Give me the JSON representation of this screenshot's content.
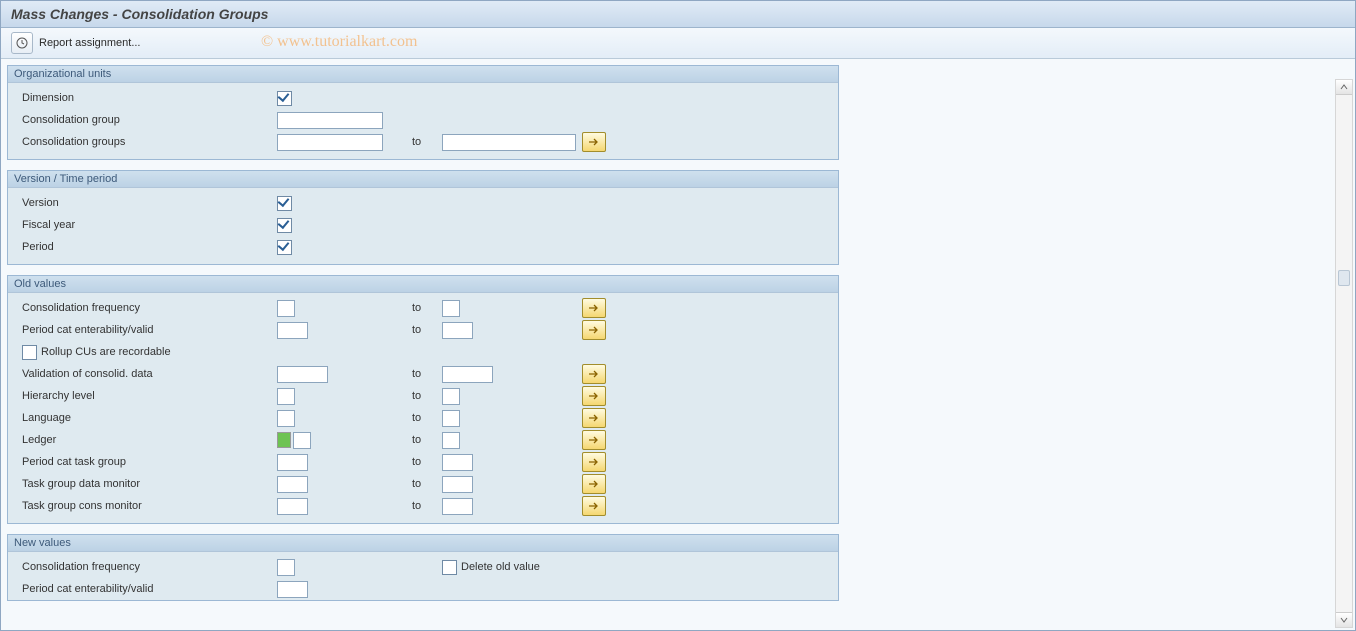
{
  "title": "Mass Changes - Consolidation Groups",
  "toolbar": {
    "report_assignment": "Report assignment..."
  },
  "watermark": "© www.tutorialkart.com",
  "to_label": "to",
  "groups": {
    "org": {
      "title": "Organizational units",
      "dimension": "Dimension",
      "cons_group": "Consolidation group",
      "cons_groups": "Consolidation groups"
    },
    "version": {
      "title": "Version / Time period",
      "version": "Version",
      "fiscal_year": "Fiscal year",
      "period": "Period"
    },
    "old": {
      "title": "Old values",
      "cons_freq": "Consolidation frequency",
      "period_cat": "Period cat enterability/valid",
      "rollup": "Rollup CUs are recordable",
      "validation": "Validation of consolid. data",
      "hierarchy": "Hierarchy level",
      "language": "Language",
      "ledger": "Ledger",
      "task_group": "Period cat task group",
      "task_data": "Task group data monitor",
      "task_cons": "Task group cons monitor"
    },
    "newv": {
      "title": "New values",
      "cons_freq": "Consolidation frequency",
      "period_cat": "Period cat enterability/valid",
      "delete_old": "Delete old value"
    }
  }
}
